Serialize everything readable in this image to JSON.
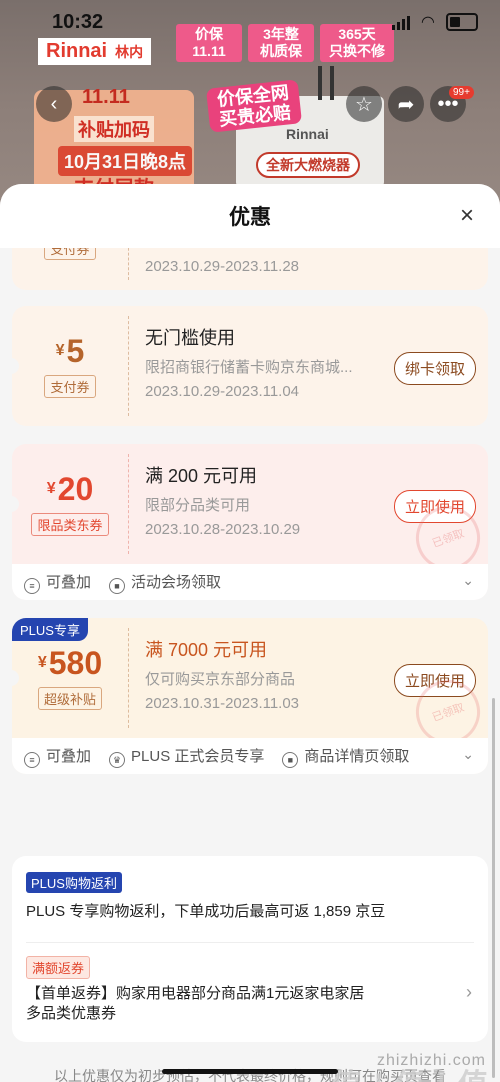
{
  "status": {
    "time": "10:32"
  },
  "background": {
    "brand": "Rinnai",
    "brand_cn": "林内",
    "tags": [
      "价保\n11.11",
      "3年整\n机质保",
      "365天\n只换不修"
    ],
    "event": {
      "t1": "11.11",
      "t2": "补贴加码",
      "t3": "10月31日晚8点",
      "t4": "支付尾款"
    },
    "slogan": "价保全网\n买贵必赔",
    "heater_label": "全新大燃烧器",
    "heater_brand": "Rinnai",
    "cart_badge": "99+"
  },
  "sheet": {
    "title": "优惠",
    "close": "×"
  },
  "coupons": [
    {
      "amount": "5",
      "tag": "支付券",
      "title": "无门槛使用",
      "desc": "限招商银行储蓄卡购京东商城...",
      "date": "2023.10.29-2023.11.04",
      "button": "绑卡领取"
    },
    {
      "amount": "20",
      "tag": "限品类东券",
      "title": "满 200 元可用",
      "desc": "限部分品类可用",
      "date": "2023.10.28-2023.10.29",
      "button": "立即使用",
      "foot": [
        "可叠加",
        "活动会场领取"
      ],
      "stamp": "已领取"
    },
    {
      "plus": "PLUS专享",
      "amount": "580",
      "tag": "超级补贴",
      "title": "满 7000 元可用",
      "desc": "仅可购买京东部分商品",
      "date": "2023.10.31-2023.11.03",
      "button": "立即使用",
      "foot": [
        "可叠加",
        "PLUS 正式会员专享",
        "商品详情页领取"
      ],
      "stamp": "已领取"
    }
  ],
  "partial_coupon": {
    "tag": "支付券",
    "date": "2023.10.29-2023.11.28"
  },
  "benefits": {
    "plus_tag": "PLUS购物返利",
    "plus_text": "PLUS 专享购物返利，下单成功后最高可返 1,859 京豆",
    "rebate_tag": "满额返券",
    "rebate_text_1": "【首单返券】购家用电器部分商品满1元返家电家居",
    "rebate_text_2": "多品类优惠券"
  },
  "disclaimer": "以上优惠仅为初步预估，不代表最终价格，规则可在购买页查看",
  "watermark": "值 | 值 | 值",
  "watermark_url": "zhizhizhi.com",
  "colors": {
    "red": "#e23b2f",
    "orange_red": "#e2472f",
    "plus_blue": "#2545b0",
    "brown": "#8b5a2b"
  }
}
